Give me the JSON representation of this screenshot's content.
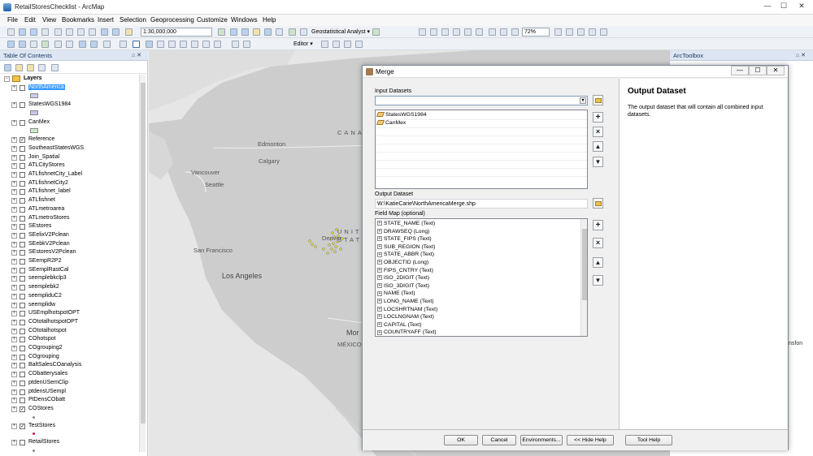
{
  "window": {
    "title": "RetailStoresChecklist - ArcMap",
    "min": "—",
    "max": "☐",
    "close": "✕"
  },
  "menus": [
    "File",
    "Edit",
    "View",
    "Bookmarks",
    "Insert",
    "Selection",
    "Geoprocessing",
    "Customize",
    "Windows",
    "Help"
  ],
  "toolbar": {
    "scale": "1:30,000,000",
    "geostat": "Geostatistical Analyst ▾",
    "zoom_pct": "72%",
    "editor": "Editor ▾"
  },
  "toc": {
    "title": "Table Of Contents",
    "pin": "⌂ ✕",
    "layers_label": "Layers",
    "layers": [
      {
        "name": "NorthAmerica",
        "checked": false,
        "selected": true,
        "swatch": "#c8cde8"
      },
      {
        "name": "StatesWGS1984",
        "checked": false,
        "swatch": "#c9c6e6"
      },
      {
        "name": "CanMex",
        "checked": false,
        "swatch": "#c7ecc4"
      },
      {
        "name": "Reference",
        "checked": true
      },
      {
        "name": "SoutheastStatesWGS",
        "checked": false
      },
      {
        "name": "Join_Spatial",
        "checked": false
      },
      {
        "name": "ATLCityStores",
        "checked": false
      },
      {
        "name": "ATLfishnetCity_Label",
        "checked": false
      },
      {
        "name": "ATLfishnetCity2",
        "checked": false
      },
      {
        "name": "ATLfishnet_label",
        "checked": false
      },
      {
        "name": "ATLfishnet",
        "checked": false
      },
      {
        "name": "ATLmetroarea",
        "checked": false
      },
      {
        "name": "ATLmetroStores",
        "checked": false
      },
      {
        "name": "SEstores",
        "checked": false
      },
      {
        "name": "SEelixV2Pclean",
        "checked": false
      },
      {
        "name": "SEebkV2Pclean",
        "checked": false
      },
      {
        "name": "SEstoresV2Pclean",
        "checked": false
      },
      {
        "name": "SEempR2P2",
        "checked": false
      },
      {
        "name": "SEemplRastCal",
        "checked": false
      },
      {
        "name": "seemplebkclp3",
        "checked": false
      },
      {
        "name": "seemplebk2",
        "checked": false
      },
      {
        "name": "seempliduC2",
        "checked": false
      },
      {
        "name": "seemplidw",
        "checked": false
      },
      {
        "name": "USEmplhotspotOPT",
        "checked": false
      },
      {
        "name": "COtotalhotspotOPT",
        "checked": false
      },
      {
        "name": "COtotalhotspot",
        "checked": false
      },
      {
        "name": "COhotspot",
        "checked": false
      },
      {
        "name": "COgrouping2",
        "checked": false
      },
      {
        "name": "COgrouping",
        "checked": false
      },
      {
        "name": "BaltSalesCOanalysis",
        "checked": false
      },
      {
        "name": "CObatterysales",
        "checked": false
      },
      {
        "name": "ptdenUSemClip",
        "checked": false
      },
      {
        "name": "ptdensUSempl",
        "checked": false
      },
      {
        "name": "PtDensCObatt",
        "checked": false
      },
      {
        "name": "COStores",
        "checked": true
      },
      {
        "name": "TestStores",
        "checked": true
      },
      {
        "name": "RetailStores",
        "checked": false
      }
    ]
  },
  "map": {
    "labels": [
      "CANA",
      "Edmonton",
      "Calgary",
      "Vancouver",
      "Seattle",
      "San Francisco",
      "Los Angeles",
      "Denver",
      "UNITED",
      "STAT",
      "Mor",
      "MÉXICO"
    ]
  },
  "arctoolbox": {
    "title": "ArcToolbox",
    "pin": "⌂ ✕",
    "clipped_text": "nsfon"
  },
  "merge": {
    "title": "Merge",
    "input_datasets_label": "Input Datasets",
    "input_datasets": [
      "StatesWGS1984",
      "CanMex"
    ],
    "output_dataset_label": "Output Dataset",
    "output_dataset_value": "W:\\KatieCarie\\NorthAmericaMerge.shp",
    "field_map_label": "Field Map (optional)",
    "fields": [
      "STATE_NAME (Text)",
      "DRAWSEQ (Long)",
      "STATE_FIPS (Text)",
      "SUB_REGION (Text)",
      "STATE_ABBR (Text)",
      "OBJECTID (Long)",
      "FIPS_CNTRY (Text)",
      "ISO_2DIGIT (Text)",
      "ISO_3DIGIT (Text)",
      "NAME (Text)",
      "LONG_NAME (Text)",
      "LOCSHRTNAM (Text)",
      "LOCLNGNAM (Text)",
      "CAPITAL (Text)",
      "COUNTRYAFF (Text)"
    ],
    "help_title": "Output Dataset",
    "help_text": "The output dataset that will contain all combined input datasets.",
    "buttons": {
      "ok": "OK",
      "cancel": "Cancel",
      "environments": "Environments...",
      "hide_help": "<< Hide Help",
      "tool_help": "Tool Help"
    },
    "win_buttons": {
      "min": "—",
      "max": "☐",
      "close": "✕"
    }
  },
  "colors": {
    "selection": "#3399ff",
    "map_bg": "#e4e4e4",
    "land": "#cfcfcf",
    "water": "#e9e9e9",
    "points": "#e6e630"
  }
}
